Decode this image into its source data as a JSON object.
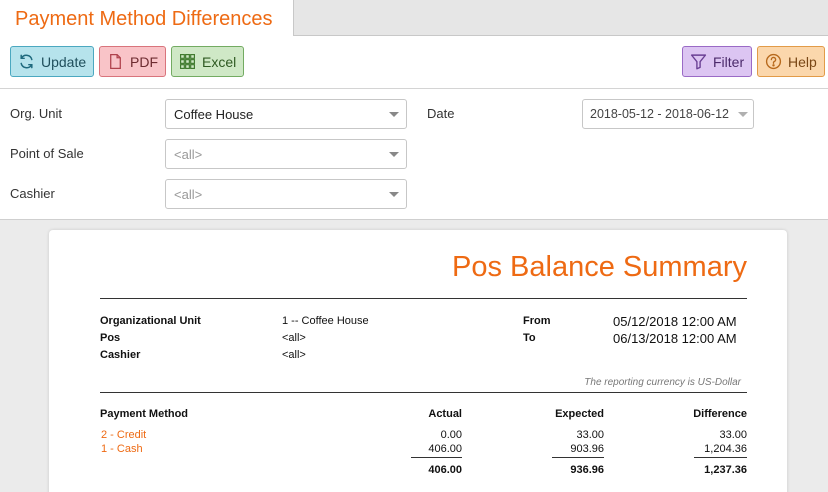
{
  "tab": {
    "title": "Payment Method Differences"
  },
  "toolbar": {
    "update_label": "Update",
    "pdf_label": "PDF",
    "excel_label": "Excel",
    "filter_label": "Filter",
    "help_label": "Help"
  },
  "filters": {
    "org_unit_label": "Org. Unit",
    "org_unit_value": "Coffee House",
    "pos_label": "Point of Sale",
    "pos_value": "<all>",
    "cashier_label": "Cashier",
    "cashier_value": "<all>",
    "date_label": "Date",
    "date_value": "2018-05-12 - 2018-06-12"
  },
  "report": {
    "title": "Pos Balance Summary",
    "meta": {
      "org_unit_label": "Organizational Unit",
      "org_unit_value": "1 -- Coffee House",
      "pos_label": "Pos",
      "pos_value": "<all>",
      "cashier_label": "Cashier",
      "cashier_value": "<all>",
      "from_label": "From",
      "from_value": "05/12/2018 12:00 AM",
      "to_label": "To",
      "to_value": "06/13/2018 12:00 AM"
    },
    "currency_note": "The reporting currency is US-Dollar",
    "columns": [
      "Payment Method",
      "Actual",
      "Expected",
      "Difference"
    ],
    "rows": [
      {
        "method": "2 - Credit",
        "actual": "0.00",
        "expected": "33.00",
        "difference": "33.00"
      },
      {
        "method": "1 - Cash",
        "actual": "406.00",
        "expected": "903.96",
        "difference": "1,204.36"
      }
    ],
    "totals": {
      "actual": "406.00",
      "expected": "936.96",
      "difference": "1,237.36"
    }
  },
  "colors": {
    "accent": "#ee6a13",
    "update": "#b6e3ec",
    "pdf": "#f9c4c8",
    "excel": "#cfe8c6",
    "filter": "#dcc5f2",
    "help": "#fbd7ac"
  }
}
